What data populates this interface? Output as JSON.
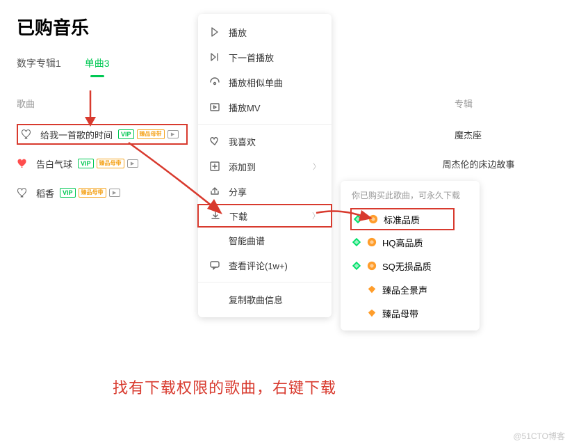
{
  "page_title": "已购音乐",
  "tabs": {
    "digital_album": "数字专辑1",
    "single": "单曲3"
  },
  "columns": {
    "song": "歌曲",
    "album": "专辑"
  },
  "badges": {
    "vip": "VIP",
    "master": "臻品母带",
    "mv": "▶"
  },
  "rows": [
    {
      "title": "给我一首歌的时间",
      "album": "魔杰座",
      "liked": false
    },
    {
      "title": "告白气球",
      "album": "周杰伦的床边故事",
      "liked": true
    },
    {
      "title": "稻香",
      "album": "",
      "liked": false
    }
  ],
  "context_menu": {
    "play": "播放",
    "play_next": "下一首播放",
    "play_similar": "播放相似单曲",
    "play_mv": "播放MV",
    "like": "我喜欢",
    "add_to": "添加到",
    "share": "分享",
    "download": "下载",
    "smart_score": "智能曲谱",
    "view_comments": "查看评论(1w+)",
    "copy_info": "复制歌曲信息"
  },
  "submenu": {
    "title": "你已购买此歌曲，可永久下载",
    "items": [
      {
        "label": "标准品质",
        "green": true,
        "orange": true
      },
      {
        "label": "HQ高品质",
        "green": true,
        "orange": true
      },
      {
        "label": "SQ无损品质",
        "green": true,
        "orange": true
      },
      {
        "label": "臻品全景声",
        "green": false,
        "orange": true
      },
      {
        "label": "臻品母带",
        "green": false,
        "orange": true
      }
    ]
  },
  "annotation": "找有下载权限的歌曲，右键下载",
  "watermark": "@51CTO博客"
}
